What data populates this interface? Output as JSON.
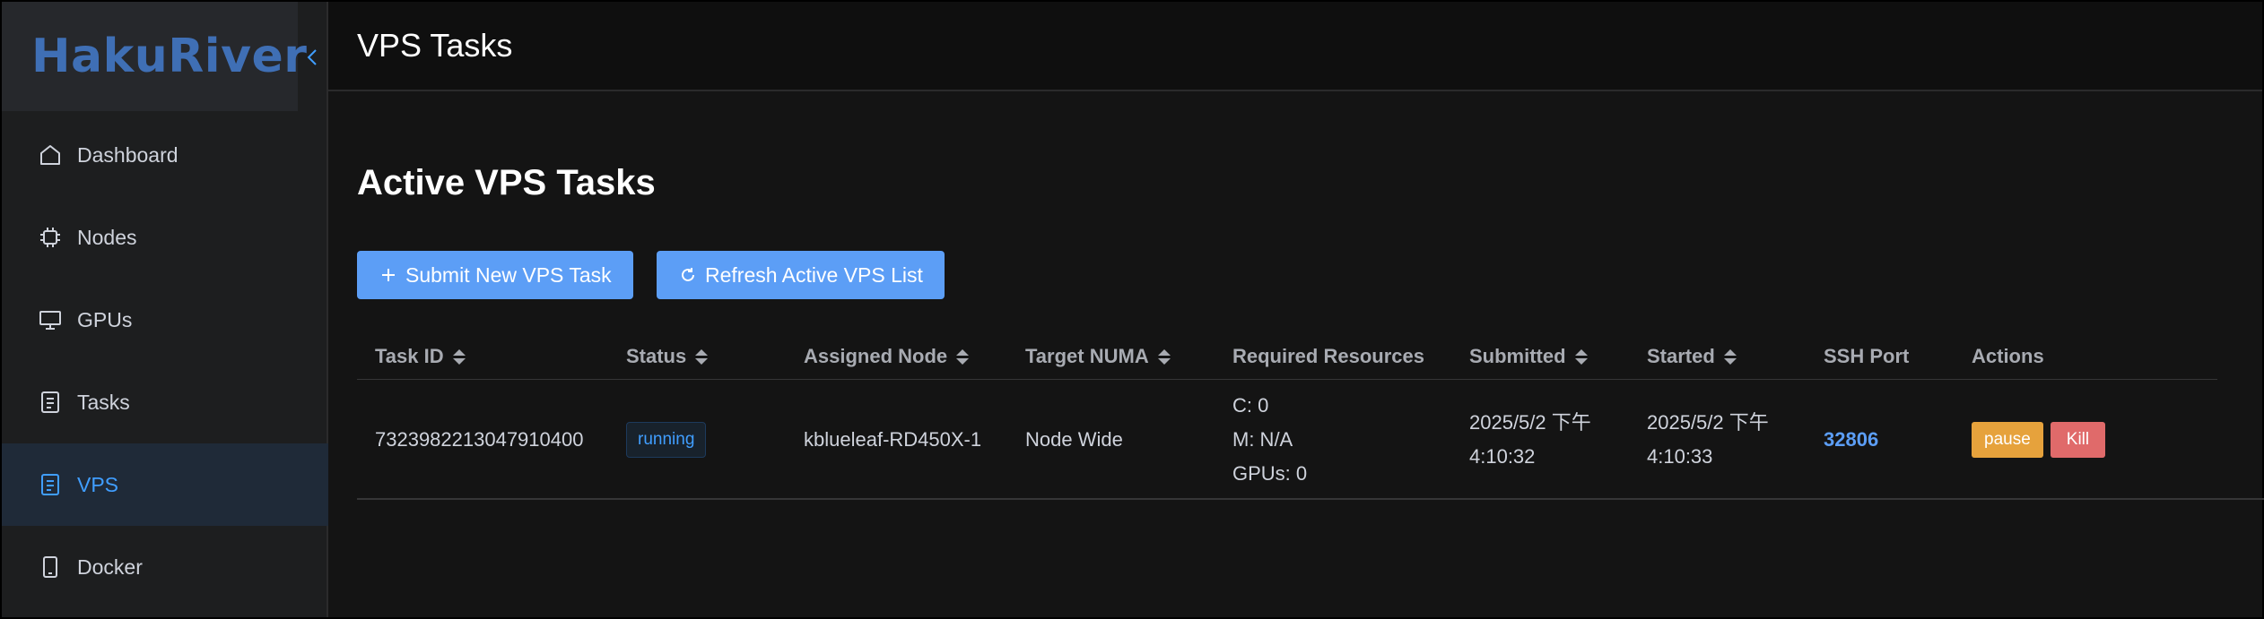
{
  "app": {
    "logo": "HakuRiver",
    "page_title": "VPS Tasks"
  },
  "sidebar": {
    "items": [
      {
        "label": "Dashboard",
        "icon": "home-icon",
        "active": false
      },
      {
        "label": "Nodes",
        "icon": "chip-icon",
        "active": false
      },
      {
        "label": "GPUs",
        "icon": "monitor-icon",
        "active": false
      },
      {
        "label": "Tasks",
        "icon": "document-icon",
        "active": false
      },
      {
        "label": "VPS",
        "icon": "document-icon",
        "active": true
      },
      {
        "label": "Docker",
        "icon": "tablet-icon",
        "active": false
      }
    ]
  },
  "main": {
    "section_title": "Active VPS Tasks",
    "submit_button": "Submit New VPS Task",
    "refresh_button": "Refresh Active VPS List",
    "table": {
      "columns": [
        "Task ID",
        "Status",
        "Assigned Node",
        "Target NUMA",
        "Required Resources",
        "Submitted",
        "Started",
        "SSH Port",
        "Actions"
      ],
      "rows": [
        {
          "task_id": "7323982213047910400",
          "status": "running",
          "assigned_node": "kblueleaf-RD450X-1",
          "target_numa": "Node Wide",
          "res_c": "C: 0",
          "res_m": "M: N/A",
          "res_gpus": "GPUs: 0",
          "submitted_date": "2025/5/2 下午",
          "submitted_time": "4:10:32",
          "started_date": "2025/5/2 下午",
          "started_time": "4:10:33",
          "ssh_port": "32806",
          "pause_label": "pause",
          "kill_label": "Kill"
        }
      ]
    }
  },
  "colors": {
    "accent": "#409eff",
    "button": "#5c9ef6",
    "pause": "#e6a23c",
    "kill": "#e06a6a",
    "logo": "#3f6fb5"
  }
}
